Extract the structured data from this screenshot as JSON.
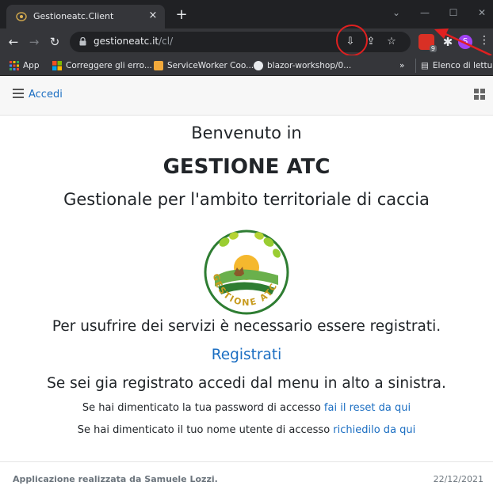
{
  "browser": {
    "tab_title": "Gestioneatc.Client",
    "tab_close": "×",
    "new_tab": "+",
    "url_host": "gestioneatc.it",
    "url_path": "/cl/",
    "extension_badge": "9",
    "profile_initial": "S"
  },
  "bookmarks": {
    "items": [
      "App",
      "Correggere gli erro...",
      "ServiceWorker Coo...",
      "blazor-workshop/0..."
    ],
    "overflow": "»",
    "reading_list": "Elenco di lettura"
  },
  "appbar": {
    "login_label": "Accedi"
  },
  "main": {
    "welcome": "Benvenuto in",
    "app_name": "GESTIONE ATC",
    "subtitle": "Gestionale per l'ambito territoriale di caccia",
    "logo_text": "GESTIONE ATC",
    "notice": "Per usufrire dei servizi è necessario essere registrati.",
    "register_label": "Registrati",
    "already_registered": "Se sei gia registrato accedi dal menu in alto a sinistra.",
    "reset_text": "Se hai dimenticato la tua password di accesso ",
    "reset_link": "fai il reset da qui",
    "username_text": "Se hai dimenticato il tuo nome utente di accesso ",
    "username_link": "richiedilo da qui"
  },
  "footer": {
    "credit": "Applicazione realizzata da Samuele Lozzi.",
    "date": "22/12/2021"
  },
  "colors": {
    "link": "#1b6ec2",
    "chrome_dark": "#202124",
    "chrome_toolbar": "#35363a",
    "annotation_red": "#e02020"
  }
}
